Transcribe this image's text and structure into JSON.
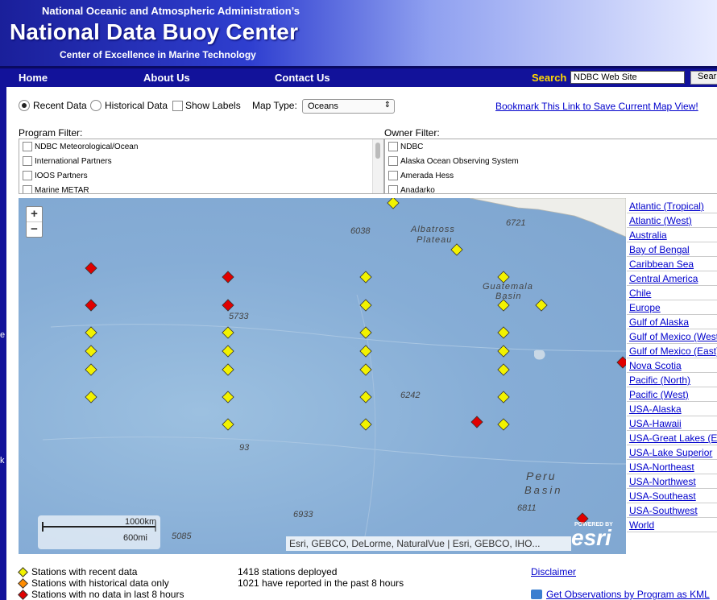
{
  "header": {
    "agency": "National Oceanic and Atmospheric Administration’s",
    "title": "National Data Buoy Center",
    "subtitle": "Center of Excellence in Marine Technology"
  },
  "nav": {
    "home": "Home",
    "about": "About Us",
    "contact": "Contact Us",
    "search_label": "Search",
    "search_value": "NDBC Web Site",
    "search_button": "Sear"
  },
  "controls": {
    "recent": "Recent Data",
    "historical": "Historical Data",
    "show_labels": "Show Labels",
    "map_type_label": "Map Type:",
    "map_type_value": "Oceans",
    "bookmark": "Bookmark This Link to Save Current Map View!"
  },
  "program_filter": {
    "label": "Program Filter:",
    "items": [
      "NDBC Meteorological/Ocean",
      "International Partners",
      "IOOS Partners",
      "Marine METAR"
    ]
  },
  "owner_filter": {
    "label": "Owner Filter:",
    "items": [
      "NDBC",
      "Alaska Ocean Observing System",
      "Amerada Hess",
      "Anadarko"
    ]
  },
  "map": {
    "labels": {
      "d6038": "6038",
      "d6721": "6721",
      "albatross1": "Albatross",
      "albatross2": "Plateau",
      "guatemala1": "Guatemala",
      "guatemala2": "Basin",
      "d5733": "5733",
      "d6242": "6242",
      "d93": "93",
      "peru1": "Peru",
      "peru2": "Basin",
      "d6933": "6933",
      "d6811": "6811",
      "d5085": "5085"
    },
    "scale_km": "1000km",
    "scale_mi": "600mi",
    "attribution": "Esri, GEBCO, DeLorme, NaturalVue | Esri, GEBCO, IHO...",
    "powered_by": "POWERED BY",
    "esri": "esri",
    "colors": {
      "recent": "#f2f200",
      "historical": "#ff8c00",
      "nodata": "#e00000"
    }
  },
  "regions": [
    "Atlantic (Tropical)",
    "Atlantic (West)",
    "Australia",
    "Bay of Bengal",
    "Caribbean Sea",
    "Central America",
    "Chile",
    "Europe",
    "Gulf of Alaska",
    "Gulf of Mexico (West",
    "Gulf of Mexico (East)/Florida",
    "Nova Scotia",
    "Pacific (North)",
    "Pacific (West)",
    "USA-Alaska",
    "USA-Hawaii",
    "USA-Great Lakes (E",
    "USA-Lake Superior",
    "USA-Northeast",
    "USA-Northwest",
    "USA-Southeast",
    "USA-Southwest",
    "World"
  ],
  "legend": {
    "recent": "Stations with recent data",
    "historical": "Stations with historical data only",
    "nodata": "Stations with no data in last 8 hours"
  },
  "stats": {
    "deployed": "1418 stations deployed",
    "reported": "1021 have reported in the past 8 hours"
  },
  "links": {
    "disclaimer": "Disclaimer",
    "kml": "Get Observations by Program as KML"
  }
}
